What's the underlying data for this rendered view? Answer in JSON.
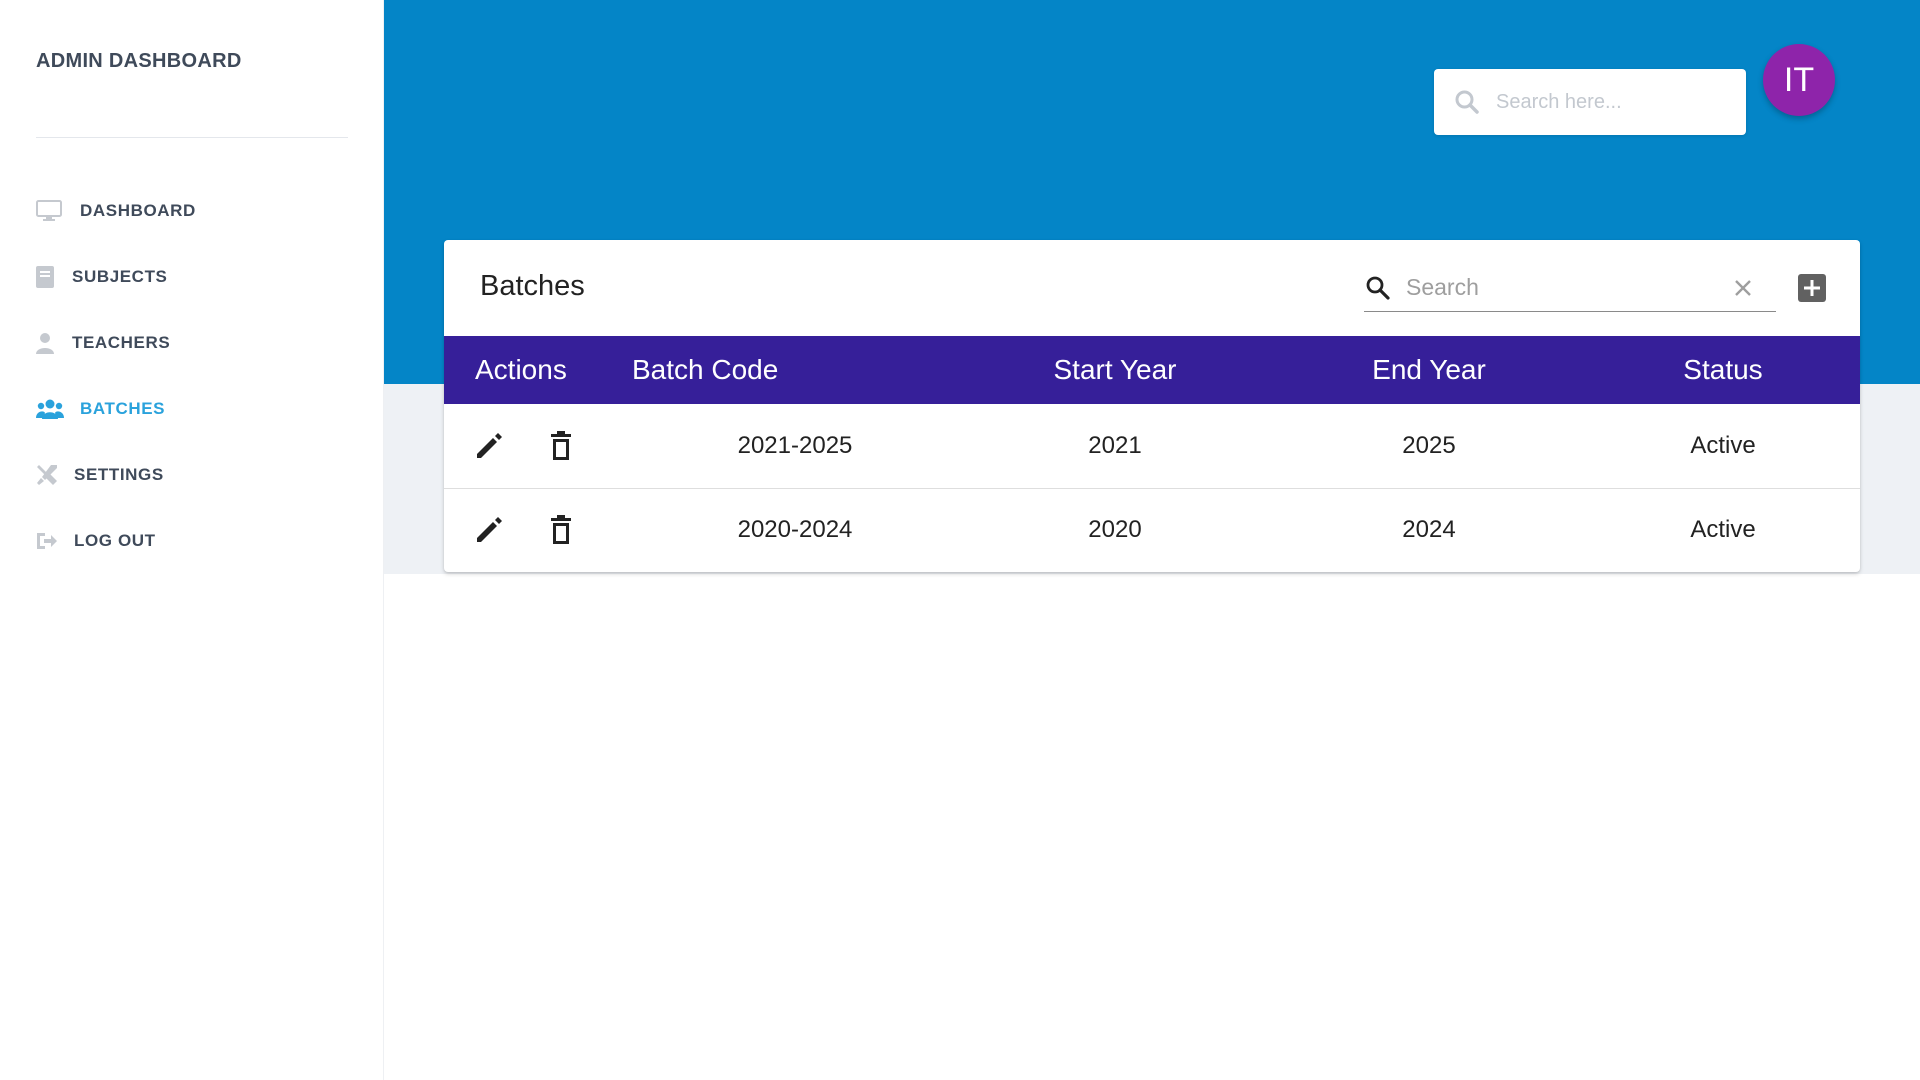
{
  "sidebar": {
    "brand": "ADMIN DASHBOARD",
    "items": [
      {
        "label": "DASHBOARD",
        "icon": "monitor-icon",
        "active": false
      },
      {
        "label": "SUBJECTS",
        "icon": "book-icon",
        "active": false
      },
      {
        "label": "TEACHERS",
        "icon": "user-icon",
        "active": false
      },
      {
        "label": "BATCHES",
        "icon": "users-icon",
        "active": true
      },
      {
        "label": "SETTINGS",
        "icon": "tools-icon",
        "active": false
      },
      {
        "label": "LOG OUT",
        "icon": "logout-icon",
        "active": false
      }
    ]
  },
  "header": {
    "search_placeholder": "Search here...",
    "avatar_initials": "IT"
  },
  "card": {
    "title": "Batches",
    "search_placeholder": "Search"
  },
  "table": {
    "columns": [
      "Actions",
      "Batch Code",
      "Start Year",
      "End Year",
      "Status"
    ],
    "rows": [
      {
        "batch_code": "2021-2025",
        "start_year": "2021",
        "end_year": "2025",
        "status": "Active"
      },
      {
        "batch_code": "2020-2024",
        "start_year": "2020",
        "end_year": "2024",
        "status": "Active"
      }
    ]
  },
  "colors": {
    "header_band": "#0485c7",
    "table_header": "#361f99",
    "active_nav": "#2aa2dc",
    "avatar": "#8e24aa"
  }
}
